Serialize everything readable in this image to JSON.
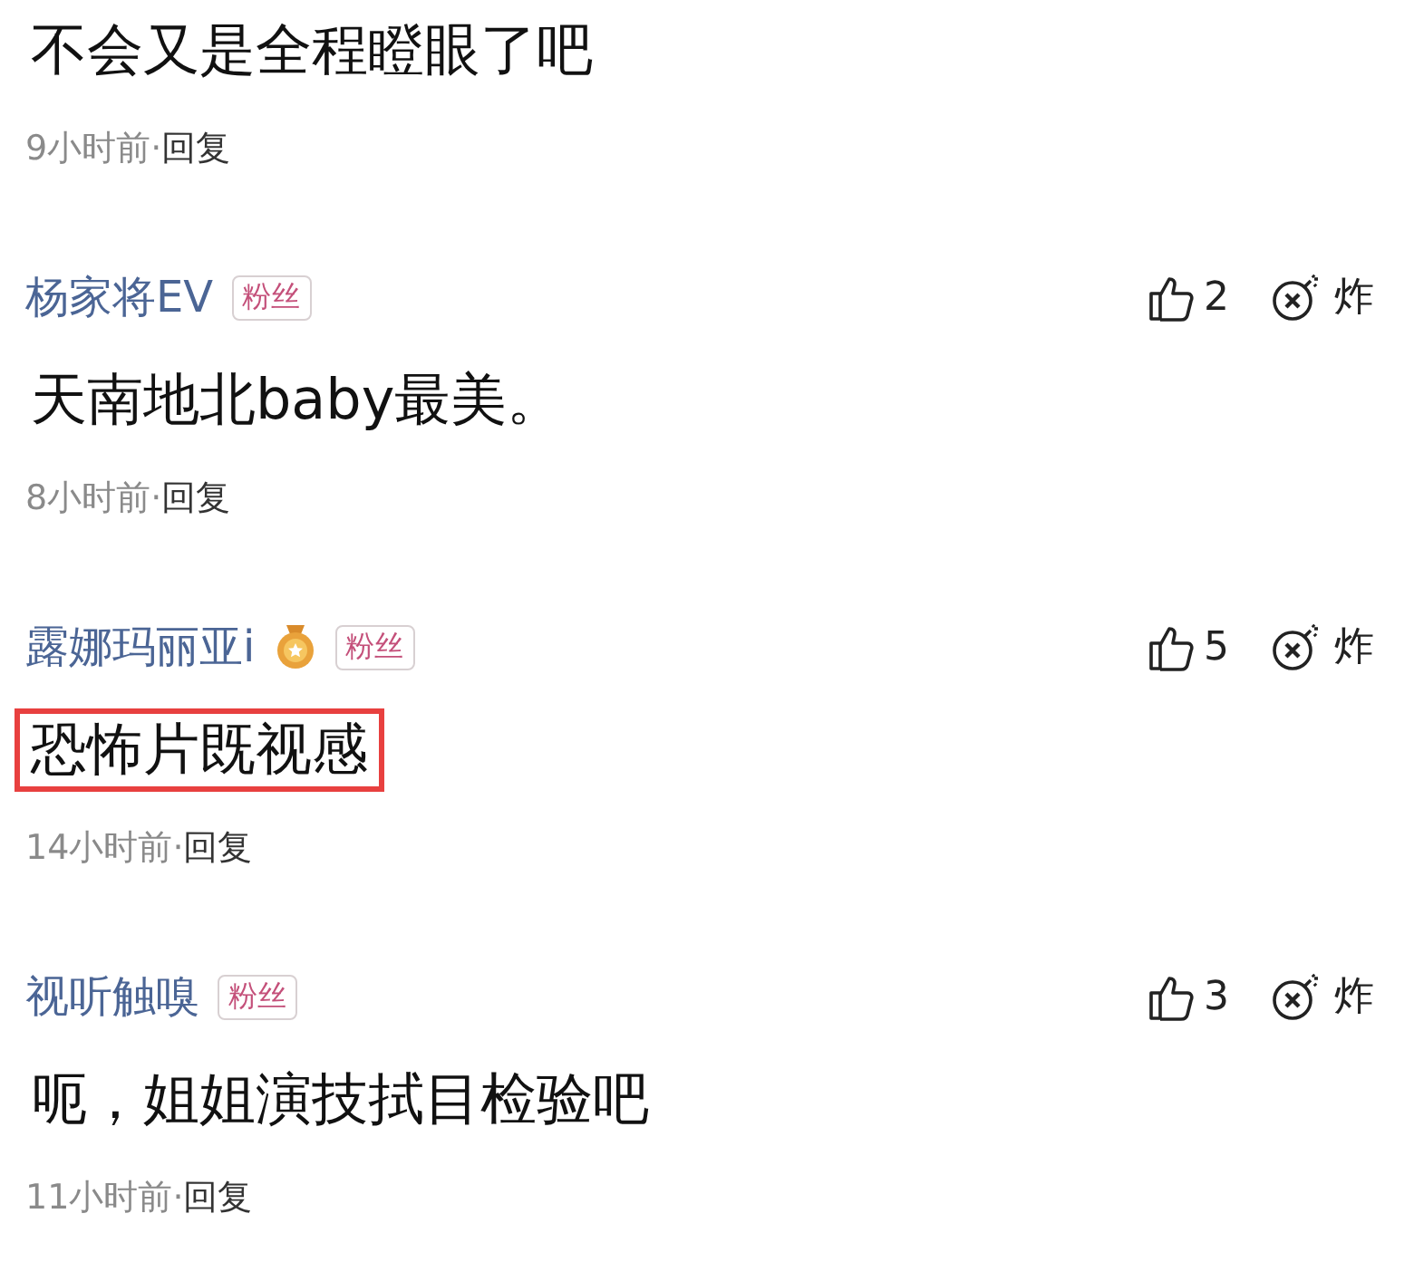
{
  "comments": [
    {
      "text": "不会又是全程瞪眼了吧",
      "time": "9小时前",
      "separator": "·",
      "reply": "回复",
      "highlighted": false
    },
    {
      "author": "杨家将EV",
      "medal": false,
      "badge": "粉丝",
      "likes": "2",
      "bomb": "炸",
      "text": "天南地北baby最美。",
      "time": "8小时前",
      "separator": "·",
      "reply": "回复",
      "highlighted": false
    },
    {
      "author": "露娜玛丽亚i",
      "medal": true,
      "badge": "粉丝",
      "likes": "5",
      "bomb": "炸",
      "text": "恐怖片既视感",
      "time": "14小时前",
      "separator": "·",
      "reply": "回复",
      "highlighted": true
    },
    {
      "author": "视听触嗅",
      "medal": false,
      "badge": "粉丝",
      "likes": "3",
      "bomb": "炸",
      "text": "呃，姐姐演技拭目检验吧",
      "time": "11小时前",
      "separator": "·",
      "reply": "回复",
      "highlighted": false
    }
  ]
}
